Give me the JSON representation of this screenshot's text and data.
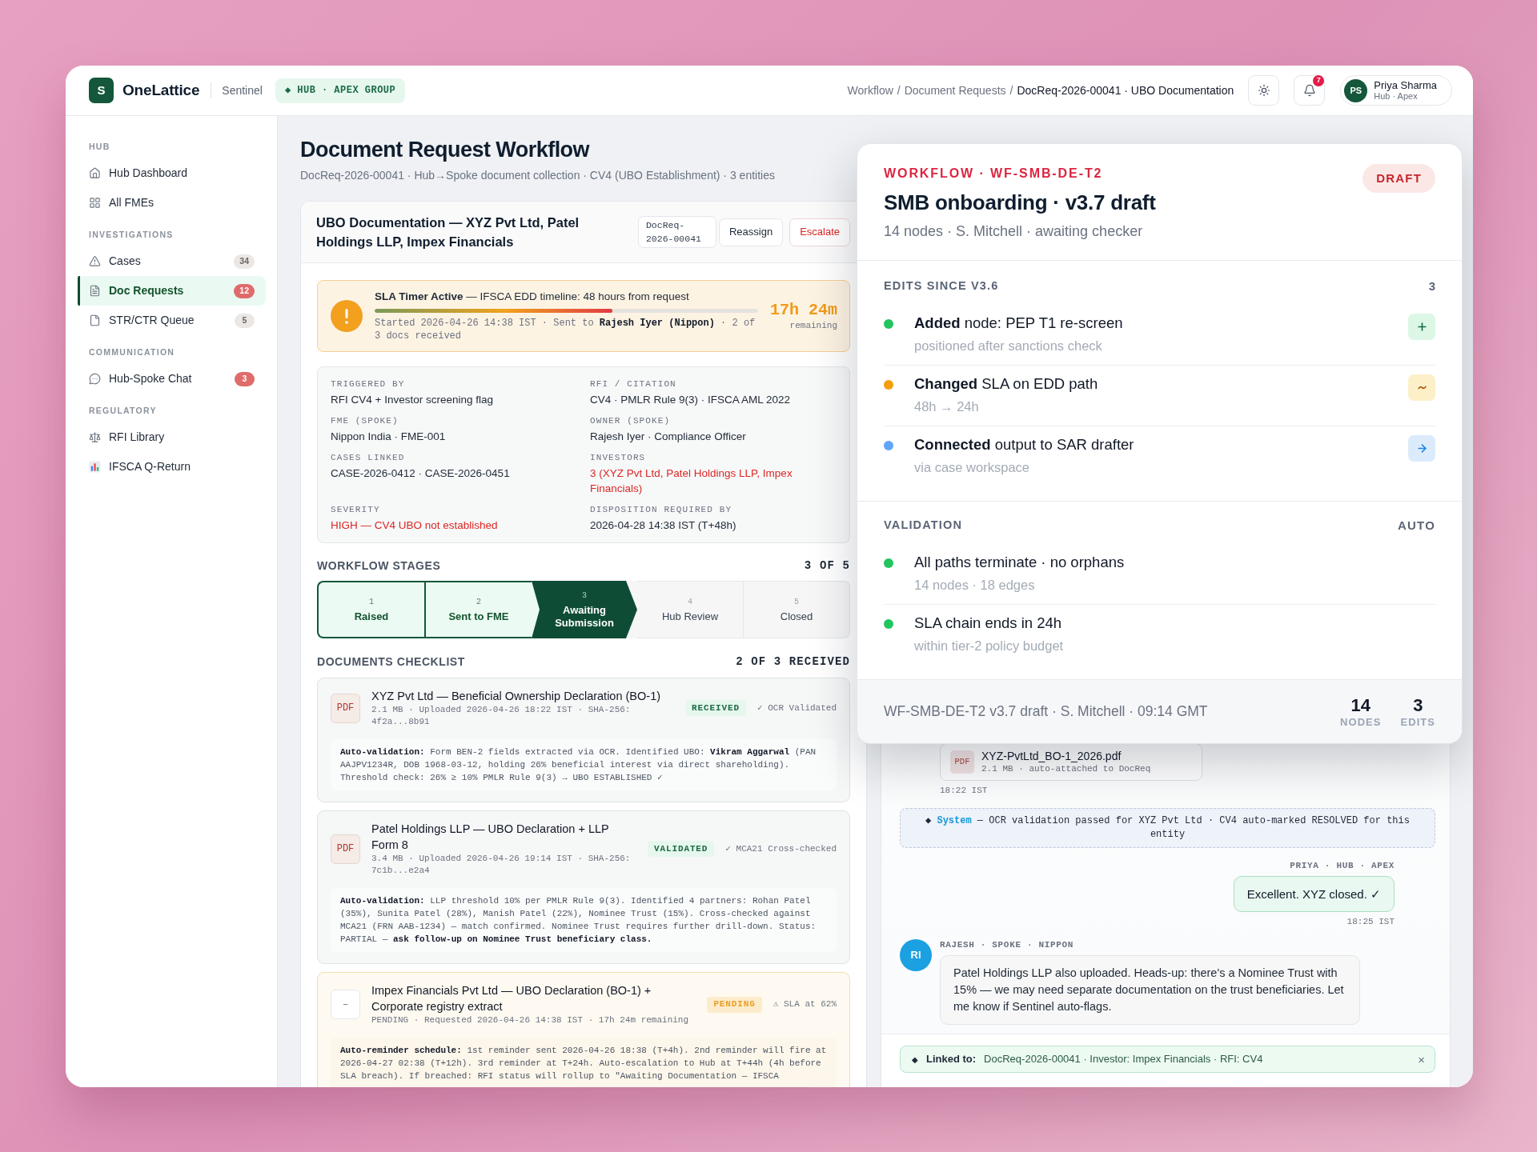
{
  "header": {
    "logo_letter": "S",
    "brand": "OneLattice",
    "product": "Sentinel",
    "context_tag": "◆ HUB · APEX GROUP",
    "breadcrumb_separator": "/",
    "breadcrumb": [
      {
        "label": "Workflow",
        "current": false
      },
      {
        "label": "Document Requests",
        "current": false
      },
      {
        "label": "DocReq-2026-00041 · UBO Documentation",
        "current": true
      }
    ],
    "notification_count": "7",
    "user": {
      "initials": "PS",
      "name": "Priya Sharma",
      "role": "Hub · Apex"
    }
  },
  "sidebar": {
    "sections": [
      {
        "title": "HUB",
        "items": [
          {
            "label": "Hub Dashboard",
            "selected": false
          },
          {
            "label": "All FMEs",
            "selected": false
          }
        ]
      },
      {
        "title": "INVESTIGATIONS",
        "items": [
          {
            "label": "Cases",
            "selected": false,
            "badge": {
              "count": "34",
              "urgent": false
            }
          },
          {
            "label": "Doc Requests",
            "selected": true,
            "badge": {
              "count": "12",
              "urgent": true
            }
          },
          {
            "label": "STR/CTR Queue",
            "selected": false,
            "badge": {
              "count": "5",
              "urgent": false
            }
          }
        ]
      },
      {
        "title": "COMMUNICATION",
        "items": [
          {
            "label": "Hub-Spoke Chat",
            "selected": false,
            "badge": {
              "count": "3",
              "urgent": true
            }
          }
        ]
      },
      {
        "title": "REGULATORY",
        "items": [
          {
            "label": "RFI Library",
            "selected": false
          },
          {
            "label": "IFSCA Q-Return",
            "selected": false
          }
        ]
      }
    ]
  },
  "page": {
    "title": "Document Request Workflow",
    "subtitle": "DocReq-2026-00041 · Hub→Spoke document collection · CV4 (UBO Establishment) · 3 entities"
  },
  "request_card": {
    "title": "UBO Documentation — XYZ Pvt Ltd, Patel Holdings LLP, Impex Financials",
    "reference": "DocReq-2026-00041",
    "actions": [
      {
        "label": "Reassign",
        "kind": "default"
      },
      {
        "label": "Escalate",
        "kind": "danger"
      }
    ],
    "sla": {
      "title": "**SLA Timer Active** — IFSCA EDD timeline: 48 hours from request",
      "level": 0.62,
      "details": "Started 2026-04-26 14:38 IST · Sent to **Rajesh Iyer (Nippon)** · 2 of 3 docs received",
      "remaining": "17h 24m",
      "remaining_label": "remaining"
    },
    "details": [
      {
        "label": "TRIGGERED BY",
        "value": "RFI CV4 + Investor screening flag",
        "flagged": false
      },
      {
        "label": "RFI / CITATION",
        "value": "CV4 · PMLR Rule 9(3) · IFSCA AML 2022",
        "flagged": false
      },
      {
        "label": "FME (SPOKE)",
        "value": "Nippon India · FME-001",
        "flagged": false
      },
      {
        "label": "OWNER (SPOKE)",
        "value": "Rajesh Iyer · Compliance Officer",
        "flagged": false
      },
      {
        "label": "CASES LINKED",
        "value": "CASE-2026-0412 · CASE-2026-0451",
        "flagged": false
      },
      {
        "label": "INVESTORS",
        "value": "3 (XYZ Pvt Ltd, Patel Holdings LLP, Impex Financials)",
        "flagged": true
      },
      {
        "label": "SEVERITY",
        "value": "HIGH — CV4 UBO not established",
        "flagged": true
      },
      {
        "label": "DISPOSITION REQUIRED BY",
        "value": "2026-04-28 14:38 IST (T+48h)",
        "flagged": false
      }
    ]
  },
  "workflow_stages": {
    "heading": "WORKFLOW STAGES",
    "progress": "3 OF 5",
    "items": [
      {
        "number": "1",
        "label": "Raised",
        "kind": "done"
      },
      {
        "number": "2",
        "label": "Sent to FME",
        "kind": "done"
      },
      {
        "number": "3",
        "label": "Awaiting Submission",
        "kind": "current"
      },
      {
        "number": "4",
        "label": "Hub Review",
        "kind": "upcoming"
      },
      {
        "number": "5",
        "label": "Closed",
        "kind": "upcoming"
      }
    ]
  },
  "documents": {
    "heading": "DOCUMENTS CHECKLIST",
    "progress": "2 OF 3 RECEIVED",
    "items": [
      {
        "pending": false,
        "file_type": "PDF",
        "title": "XYZ Pvt Ltd — Beneficial Ownership Declaration (BO-1)",
        "meta": "2.1 MB · Uploaded 2026-04-26 18:22 IST · SHA-256: 4f2a...8b91",
        "badge": "RECEIVED",
        "check": "✓ OCR Validated",
        "note": "**Auto-validation:** Form BEN-2 fields extracted via OCR. Identified UBO: **Vikram Aggarwal** (PAN AAJPV1234R, DOB 1968-03-12, holding 26% beneficial interest via direct shareholding). Threshold check: 26% ≥ 10% PMLR Rule 9(3) → UBO ESTABLISHED ✓"
      },
      {
        "pending": false,
        "file_type": "PDF",
        "title": "Patel Holdings LLP — UBO Declaration + LLP Form 8",
        "meta": "3.4 MB · Uploaded 2026-04-26 19:14 IST · SHA-256: 7c1b...e2a4",
        "badge": "VALIDATED",
        "check": "✓ MCA21 Cross-checked",
        "note": "**Auto-validation:** LLP threshold 10% per PMLR Rule 9(3). Identified 4 partners: Rohan Patel (35%), Sunita Patel (28%), Manish Patel (22%), Nominee Trust (15%). Cross-checked against MCA21 (FRN AAB-1234) — match confirmed. Nominee Trust requires further drill-down. Status: PARTIAL — **ask follow-up on Nominee Trust beneficiary class.**"
      },
      {
        "pending": true,
        "file_type": "–",
        "title": "Impex Financials Pvt Ltd — UBO Declaration (BO-1) + Corporate registry extract",
        "meta": "PENDING · Requested 2026-04-26 14:38 IST · 17h 24m remaining",
        "badge": "PENDING",
        "check": "⚠ SLA at 62%",
        "note": "**Auto-reminder schedule:** 1st reminder sent 2026-04-26 18:38 (T+4h). 2nd reminder will fire at 2026-04-27 02:38 (T+12h). 3rd reminder at T+24h. Auto-escalation to Hub at T+44h (4h before SLA breach). If breached: RFI status will rollup to \"Awaiting Documentation — IFSCA"
      }
    ]
  },
  "chat": {
    "messages": [
      {
        "kind": "attachment",
        "file_type": "PDF",
        "file_name": "XYZ-PvtLtd_BO-1_2026.pdf",
        "meta": "2.1 MB · auto-attached to DocReq",
        "time": "18:22 IST"
      },
      {
        "kind": "system",
        "text": "◆ **System** — OCR validation passed for XYZ Pvt Ltd · CV4 auto-marked RESOLVED for this entity"
      },
      {
        "kind": "outgoing",
        "sender": "PRIYA · HUB · APEX",
        "text": "Excellent. XYZ closed. ✓",
        "time": "18:25 IST"
      },
      {
        "kind": "incoming",
        "initials": "RI",
        "sender": "RAJESH · SPOKE · NIPPON",
        "text": "Patel Holdings LLP also uploaded. Heads-up: there's a Nominee Trust with 15% — we may need separate documentation on the trust beneficiaries. Let me know if Sentinel auto-flags."
      }
    ],
    "linked": {
      "marker": "◆",
      "label": "Linked to:",
      "value": "DocReq-2026-00041 · Investor: Impex Financials · RFI: CV4",
      "dismiss": "×"
    }
  },
  "workflow_popover": {
    "eyebrow": "WORKFLOW · WF-SMB-DE-T2",
    "status": "DRAFT",
    "title": "SMB onboarding · v3.7 draft",
    "subtitle": "14 nodes · S. Mitchell · awaiting checker",
    "edits": {
      "heading": "EDITS SINCE V3.6",
      "count": "3",
      "items": [
        {
          "kind": "added",
          "color": "#22c55e",
          "title": "**Added** node: PEP T1 re-screen",
          "detail": "positioned after sanctions check"
        },
        {
          "kind": "changed",
          "color": "#f59e0b",
          "title": "**Changed** SLA on EDD path",
          "detail": "48h → 24h"
        },
        {
          "kind": "connected",
          "color": "#60a5fa",
          "title": "**Connected** output to SAR drafter",
          "detail": "via case workspace"
        }
      ]
    },
    "validation": {
      "heading": "VALIDATION",
      "mode": "AUTO",
      "items": [
        {
          "color": "#22c55e",
          "title": "All paths terminate · no orphans",
          "detail": "14 nodes · 18 edges"
        },
        {
          "color": "#22c55e",
          "title": "SLA chain ends in 24h",
          "detail": "within tier-2 policy budget"
        }
      ]
    },
    "footer": {
      "text": "WF-SMB-DE-T2 v3.7 draft · S. Mitchell · 09:14 GMT",
      "stats": [
        {
          "value": "14",
          "label": "NODES"
        },
        {
          "value": "3",
          "label": "EDITS"
        }
      ]
    }
  }
}
